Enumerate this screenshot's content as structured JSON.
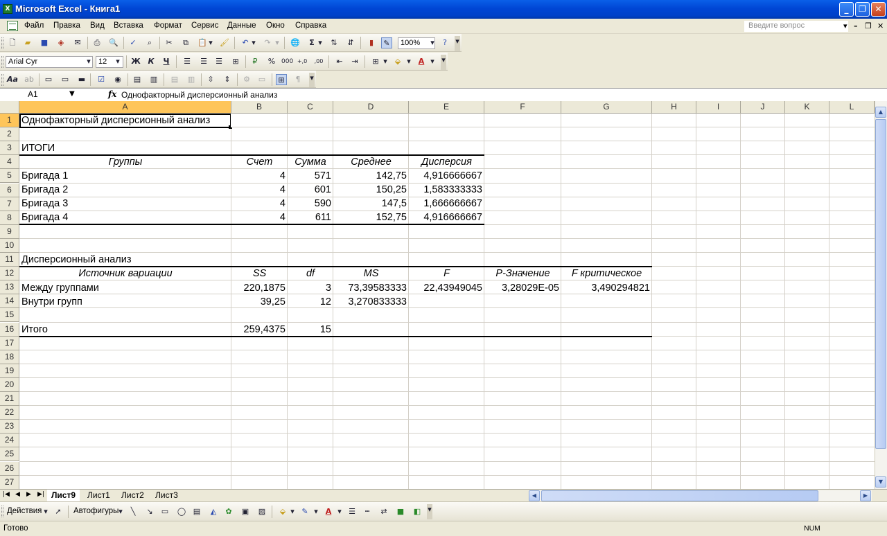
{
  "window": {
    "title": "Microsoft Excel - Книга1",
    "controls": {
      "minimize": "_",
      "restore": "❐",
      "close": "✕"
    }
  },
  "menu": {
    "items": [
      "Файл",
      "Правка",
      "Вид",
      "Вставка",
      "Формат",
      "Сервис",
      "Данные",
      "Окно",
      "Справка"
    ],
    "help_placeholder": "Введите вопрос"
  },
  "standard_toolbar": {
    "zoom": "100%"
  },
  "format_toolbar": {
    "font": "Arial Cyr",
    "size": "12",
    "bold": "Ж",
    "italic": "К",
    "underline": "Ч"
  },
  "formula_bar": {
    "name_box": "A1",
    "fx": "fx",
    "content": "Однофакторный дисперсионный анализ"
  },
  "columns": [
    "A",
    "B",
    "C",
    "D",
    "E",
    "F",
    "G",
    "H",
    "I",
    "J",
    "K",
    "L"
  ],
  "rows": [
    "1",
    "2",
    "3",
    "4",
    "5",
    "6",
    "7",
    "8",
    "9",
    "10",
    "11",
    "12",
    "13",
    "14",
    "15",
    "16",
    "17",
    "18",
    "19",
    "20",
    "21",
    "22",
    "23",
    "24",
    "25",
    "26",
    "27"
  ],
  "cells": {
    "A1": "Однофакторный дисперсионный анализ",
    "A3": "ИТОГИ",
    "A4": "Группы",
    "B4": "Счет",
    "C4": "Сумма",
    "D4": "Среднее",
    "E4": "Дисперсия",
    "A5": "Бригада 1",
    "B5": "4",
    "C5": "571",
    "D5": "142,75",
    "E5": "4,916666667",
    "A6": "Бригада 2",
    "B6": "4",
    "C6": "601",
    "D6": "150,25",
    "E6": "1,583333333",
    "A7": "Бригада 3",
    "B7": "4",
    "C7": "590",
    "D7": "147,5",
    "E7": "1,666666667",
    "A8": "Бригада 4",
    "B8": "4",
    "C8": "611",
    "D8": "152,75",
    "E8": "4,916666667",
    "A11": "Дисперсионный анализ",
    "A12": "Источник вариации",
    "B12": "SS",
    "C12": "df",
    "D12": "MS",
    "E12": "F",
    "F12": "P-Значение",
    "G12": "F критическое",
    "A13": "Между группами",
    "B13": "220,1875",
    "C13": "3",
    "D13": "73,39583333",
    "E13": "22,43949045",
    "F13": "3,28029E-05",
    "G13": "3,490294821",
    "A14": "Внутри групп",
    "B14": "39,25",
    "C14": "12",
    "D14": "3,270833333",
    "A16": "Итого",
    "B16": "259,4375",
    "C16": "15"
  },
  "sheet_tabs": [
    "Лист9",
    "Лист1",
    "Лист2",
    "Лист3"
  ],
  "active_sheet": "Лист9",
  "drawing_toolbar": {
    "actions": "Действия",
    "autoshapes": "Автофигуры"
  },
  "status": {
    "left": "Готово",
    "num": "NUM"
  },
  "colors": {
    "titlebar": "#0046d5",
    "selected_header": "#fec55a",
    "chrome": "#ece9d8"
  }
}
